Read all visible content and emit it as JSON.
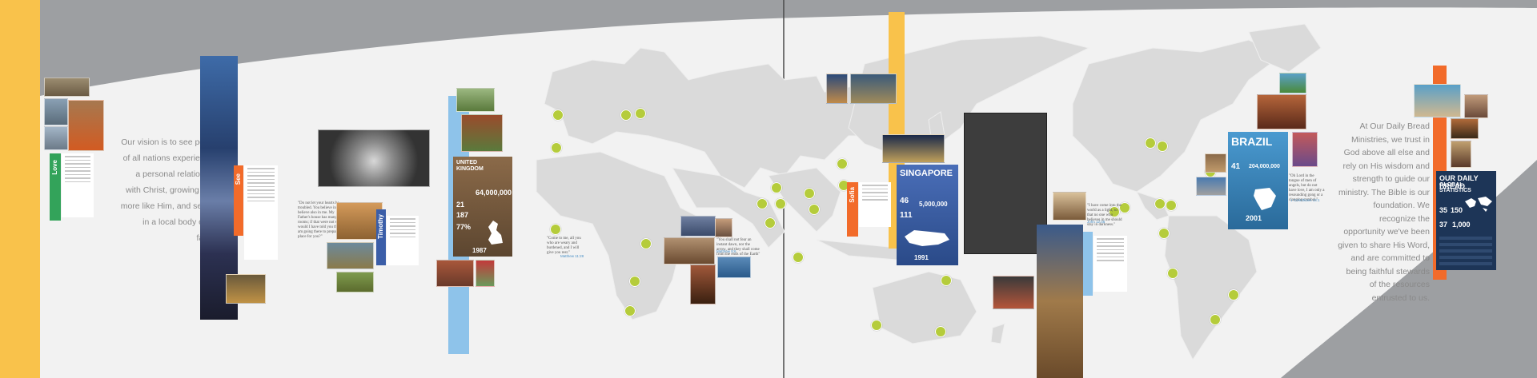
{
  "colors": {
    "panel_gray": "#9d9fa2",
    "wall_white": "#f2f2f2",
    "map_land": "#dadada",
    "yellow": "#f9c24b",
    "orange": "#f26b2a",
    "blue_light": "#8ec3ea",
    "green": "#33a35a",
    "pin_green": "#b5cc3b",
    "uk_brown": "#7a5a3c",
    "singapore_blue": "#3b5ea8",
    "brazil_blue": "#3f8fc0",
    "stats_navy": "#1d3557",
    "blank_panel": "#3d3d3d"
  },
  "vision": {
    "text": "Our vision is to see people of all nations experiencing a personal relationship with Christ, growing to be more like Him, and serving in a local body of His family."
  },
  "trust": {
    "text": "At Our Daily Bread Ministries, we trust in God above all else and rely on His wisdom and strength to guide our ministry. The Bible is our foundation. We recognize the opportunity we've been given to share His Word, and are committed to being faithful stewards of the resources entrusted to us."
  },
  "panels": {
    "see": {
      "label": "See"
    },
    "love": {
      "label": "Love"
    },
    "timothy": {
      "label": "Timothy"
    },
    "sofia": {
      "label": "Sofia"
    }
  },
  "quotes": {
    "matthew": {
      "text": "\"Come to me, all you who are weary and burdened, and I will give you rest.\"",
      "source": "Matthew 11:28"
    },
    "matthew2": {
      "text": "\"You shall not fear an instant dawn, nor the arrow, and they shall come from the ends of the Earth\"",
      "source": "Matthew 8:6"
    },
    "mid": {
      "text": "\"I have come into the world as a light, so that no one who believes in me should stay in darkness.\"",
      "source": "John 12:46"
    },
    "brazil": {
      "text": "\"Oh Lord in the tongue of men of angels, but do not have love, I am only a resounding gong or a clanging cymbal.\"",
      "source": "1 Corinthians 13:1"
    }
  },
  "uk": {
    "title1": "UNITED",
    "title2": "KINGDOM",
    "big": "64,000,000",
    "n1": "21",
    "n2": "187",
    "n3": "77%",
    "year": "1987"
  },
  "singapore": {
    "title": "SINGAPORE",
    "n1": "46",
    "n2": "111",
    "big": "5,000,000",
    "year": "1991"
  },
  "brazil": {
    "title": "BRAZIL",
    "n1": "41",
    "n2": "",
    "big": "204,000,000",
    "year": "2001"
  },
  "global": {
    "title1": "OUR DAILY BREAD",
    "title2": "GLOBAL STATISTICS",
    "n1": "35",
    "n2": "150",
    "n3": "37",
    "n4": "1,000"
  }
}
